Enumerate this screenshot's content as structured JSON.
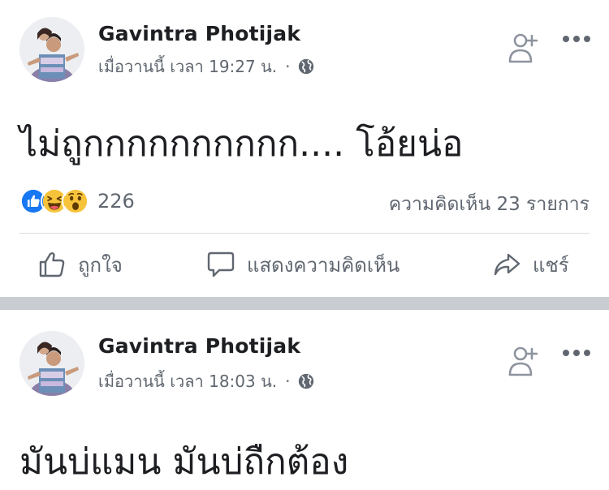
{
  "posts": [
    {
      "author": "Gavintra Photijak",
      "timestamp": "เมื่อวานนี้ เวลา 19:27 น.",
      "separator": "·",
      "privacy_icon": "globe-icon",
      "text": "ไม่ถูกกกกกกกกกก.... โอ้ยน่อ",
      "reactions": [
        "like",
        "haha",
        "wow"
      ],
      "reaction_count": "226",
      "comment_count_label": "ความคิดเห็น 23 รายการ",
      "actions": {
        "like": "ถูกใจ",
        "comment": "แสดงความคิดเห็น",
        "share": "แชร์"
      }
    },
    {
      "author": "Gavintra Photijak",
      "timestamp": "เมื่อวานนี้ เวลา 18:03 น.",
      "separator": "·",
      "privacy_icon": "globe-icon",
      "text": "มันบ่แมน มันบ่ถืกต้อง"
    }
  ],
  "colors": {
    "text_primary": "#1c1e21",
    "text_secondary": "#606770",
    "like_blue": "#1877f2",
    "reaction_yellow": "#f7c33b",
    "separator": "#c9ccd1",
    "divider": "#dadde1"
  }
}
